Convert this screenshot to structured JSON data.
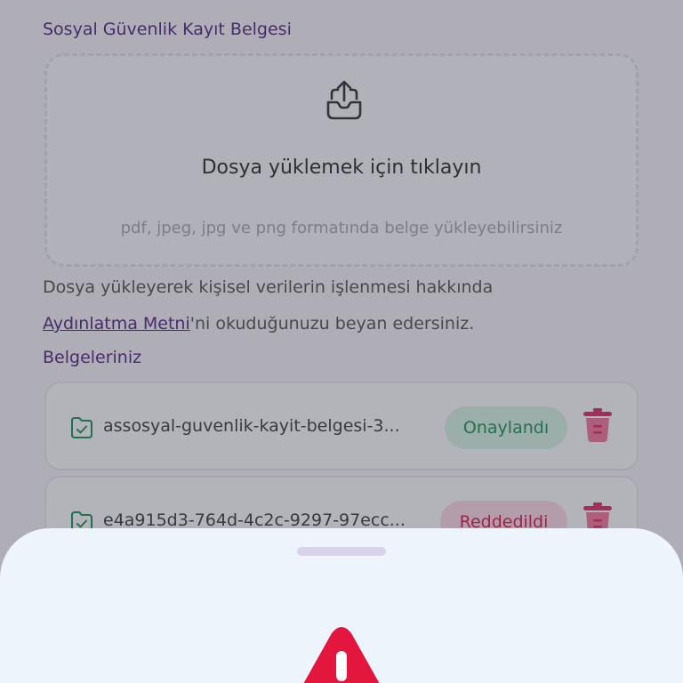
{
  "upload_section": {
    "title": "Sosyal Güvenlik Kayıt Belgesi",
    "upload_icon": "upload-tray-icon",
    "upload_text": "Dosya yüklemek için tıklayın",
    "upload_hint": "pdf, jpeg, jpg ve png formatında belge yükleyebilirsiniz"
  },
  "consent": {
    "line1": "Dosya yükleyerek kişisel verilerin işlenmesi hakkında",
    "link_text": "Aydınlatma Metni",
    "line2_rest": "'ni okuduğunuzu beyan edersiniz."
  },
  "documents": {
    "title": "Belgeleriniz",
    "items": [
      {
        "name": "assosyal-guvenlik-kayit-belgesi-3...",
        "status": "Onaylandı",
        "icon": "file-check-icon"
      },
      {
        "name": "e4a915d3-764d-4c2c-9297-97ecc...",
        "status": "Reddedildi",
        "icon": "file-check-icon"
      }
    ]
  },
  "bottom_sheet": {
    "icon": "warning-icon"
  },
  "colors": {
    "brand_purple": "#5b2d86",
    "approved_text": "#1f9a5b",
    "approved_bg": "#d6f2e3",
    "rejected_text": "#d92452",
    "rejected_bg": "#fbd9e3",
    "warning_red": "#e3173e",
    "trash_pink": "#e0356a"
  }
}
